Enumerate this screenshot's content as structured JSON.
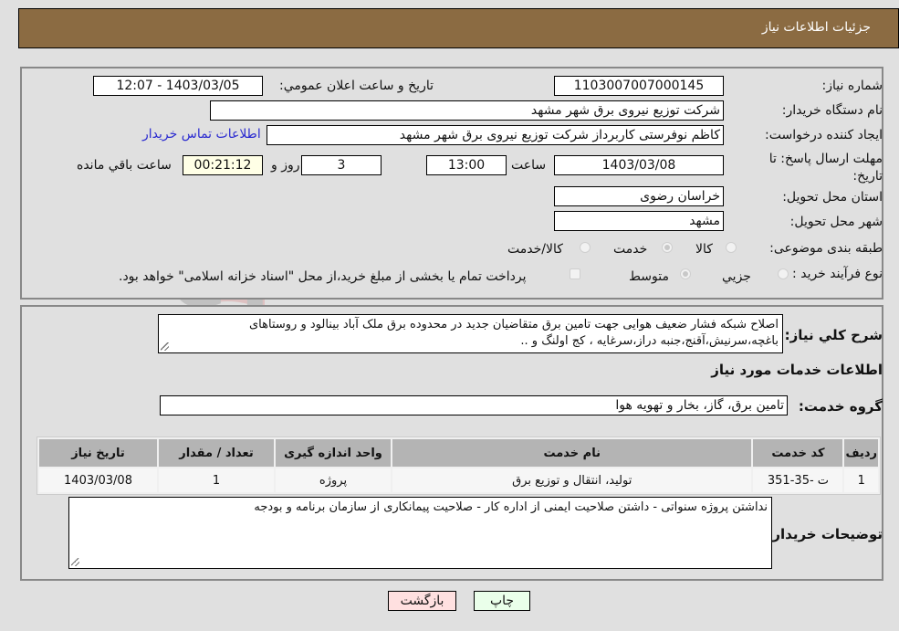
{
  "header": {
    "title": "جزئيات اطلاعات نیاز"
  },
  "form": {
    "need_number": {
      "label": "شماره نیاز:",
      "value": "1103007007000145"
    },
    "announce_datetime": {
      "label": "تاریخ و ساعت اعلان عمومي:",
      "value": "1403/03/05 - 12:07"
    },
    "buyer_org": {
      "label": "نام دستگاه خریدار:",
      "value": "شرکت توزیع نیروی برق شهر مشهد"
    },
    "requester": {
      "label": "ایجاد کننده درخواست:",
      "value": "کاظم نوفرستی کاربرداز شرکت توزیع نیروی برق شهر مشهد"
    },
    "buyer_contact_link": "اطلاعات تماس خریدار",
    "deadline": {
      "label": "مهلت ارسال پاسخ: تا تاریخ:",
      "date": "1403/03/08",
      "time_label": "ساعت",
      "time": "13:00",
      "days": "3",
      "days_label": "روز و",
      "remaining": "00:21:12",
      "remaining_label": "ساعت باقي مانده"
    },
    "province": {
      "label": "استان محل تحویل:",
      "value": "خراسان رضوی"
    },
    "city": {
      "label": "شهر محل تحویل:",
      "value": "مشهد"
    },
    "category": {
      "label": "طبقه بندی موضوعی:",
      "options": [
        "کالا",
        "خدمت",
        "کالا/خدمت"
      ],
      "selected": "خدمت"
    },
    "purchase_type": {
      "label": "نوع فرآیند خرید :",
      "options": [
        "جزيي",
        "متوسط"
      ],
      "selected": "متوسط",
      "treasury_note": "پرداخت تمام یا بخشی از مبلغ خرید،از محل \"اسناد خزانه اسلامی\" خواهد بود."
    }
  },
  "description": {
    "label": "شرح کلي نیاز:",
    "value": "اصلاح شبکه فشار ضعیف هوایی جهت تامین برق متقاضیان جدید در محدوده برق ملک آباد بینالود و روستاهای باغچه،سرنیش،آقنج،جنبه دراز،سرغایه ، کج اولنگ و .."
  },
  "services": {
    "section_title": "اطلاعات خدمات مورد نیاز",
    "group_label": "گروه خدمت:",
    "group_value": "تامین برق، گاز، بخار و تهویه هوا",
    "columns": [
      "ردیف",
      "کد خدمت",
      "نام خدمت",
      "واحد اندازه گیری",
      "تعداد / مقدار",
      "تاریخ نیاز"
    ],
    "rows": [
      [
        "1",
        "ت -35-351",
        "تولید، انتقال و توزیع برق",
        "پروژه",
        "1",
        "1403/03/08"
      ]
    ]
  },
  "buyer_notes": {
    "label": "توضیحات خریدار:",
    "value": "نداشتن پروژه سنواتی - داشتن صلاحیت ایمنی از اداره کار - صلاحیت پیمانکاری از سازمان برنامه و بودجه"
  },
  "buttons": {
    "print": "چاپ",
    "back": "بازگشت"
  },
  "watermark": "AriaTender.neT"
}
